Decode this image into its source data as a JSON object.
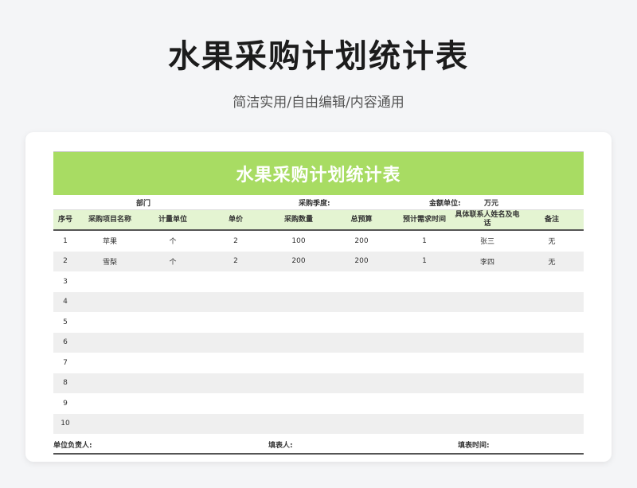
{
  "page": {
    "title": "水果采购计划统计表",
    "subtitle": "简洁实用/自由编辑/内容通用"
  },
  "sheet": {
    "banner": "水果采购计划统计表",
    "info": {
      "department": "部门",
      "quarter": "采购季度:",
      "currency_label": "金额单位:",
      "currency_value": "万元"
    },
    "columns": [
      "序号",
      "采购项目名称",
      "计量单位",
      "单价",
      "采购数量",
      "总预算",
      "预计需求时间",
      "具体联系人姓名及电话",
      "备注"
    ],
    "rows": [
      [
        "1",
        "苹果",
        "个",
        "2",
        "100",
        "200",
        "1",
        "张三",
        "无"
      ],
      [
        "2",
        "雪梨",
        "个",
        "2",
        "200",
        "200",
        "1",
        "李四",
        "无"
      ],
      [
        "3",
        "",
        "",
        "",
        "",
        "",
        "",
        "",
        ""
      ],
      [
        "4",
        "",
        "",
        "",
        "",
        "",
        "",
        "",
        ""
      ],
      [
        "5",
        "",
        "",
        "",
        "",
        "",
        "",
        "",
        ""
      ],
      [
        "6",
        "",
        "",
        "",
        "",
        "",
        "",
        "",
        ""
      ],
      [
        "7",
        "",
        "",
        "",
        "",
        "",
        "",
        "",
        ""
      ],
      [
        "8",
        "",
        "",
        "",
        "",
        "",
        "",
        "",
        ""
      ],
      [
        "9",
        "",
        "",
        "",
        "",
        "",
        "",
        "",
        ""
      ],
      [
        "10",
        "",
        "",
        "",
        "",
        "",
        "",
        "",
        ""
      ]
    ],
    "footer": {
      "owner": "单位负责人:",
      "filler": "填表人:",
      "date": "填表时间:"
    }
  },
  "colors": {
    "banner": "#a8dc63",
    "header_bg": "#e4f4d2",
    "stripe": "#efefef"
  }
}
